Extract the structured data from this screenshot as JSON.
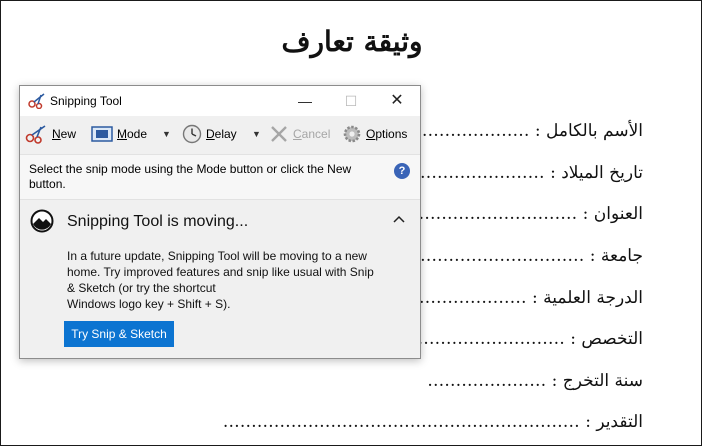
{
  "document": {
    "title": "وثيقة تعارف",
    "fields": [
      {
        "label": "الأسم  بالكامل :",
        "dots": "……………………………………"
      },
      {
        "label": "تاريخ الميلاد :",
        "dots": "……………………………"
      },
      {
        "label": "العنوان :",
        "dots": "…………………………………"
      },
      {
        "label": "جامعة :",
        "dots": "……………………………………"
      },
      {
        "label": "الدرجة العلمية :",
        "dots": "……………………………"
      },
      {
        "label": "التخصص :",
        "dots": "…………………………………"
      },
      {
        "label": "سنة التخرج :",
        "dots": "…………………"
      },
      {
        "label": "التقدير :",
        "dots": "………………………………………………………"
      }
    ]
  },
  "window": {
    "title": "Snipping Tool",
    "minimize_glyph": "—",
    "maximize_glyph": "☐",
    "close_glyph": "✕"
  },
  "toolbar": {
    "new_label_u": "N",
    "new_label_rest": "ew",
    "mode_label_u": "M",
    "mode_label_rest": "ode",
    "delay_label_u": "D",
    "delay_label_rest": "elay",
    "cancel_label_u": "C",
    "cancel_label_rest": "ancel",
    "options_label_u": "O",
    "options_label_rest": "ptions",
    "dropdown_arrow": "▼",
    "icons": {
      "new": "scissors-icon",
      "mode": "rectangle-snip-icon",
      "delay": "clock-icon",
      "cancel": "x-icon",
      "options": "gear-icon"
    }
  },
  "hint": {
    "text": "Select the snip mode using the Mode button or click the New button.",
    "help_glyph": "?"
  },
  "notice": {
    "title": "Snipping Tool is moving...",
    "body_lines": [
      "In a future update, Snipping Tool will be moving to a new",
      "home. Try improved features and snip like usual with Snip",
      "& Sketch (or try the shortcut",
      "Windows logo key + Shift + S)."
    ],
    "button_label": "Try Snip & Sketch"
  },
  "colors": {
    "accent": "#0c74d1",
    "help_blue": "#3a64b7",
    "disabled_text": "#a6a6a6"
  }
}
